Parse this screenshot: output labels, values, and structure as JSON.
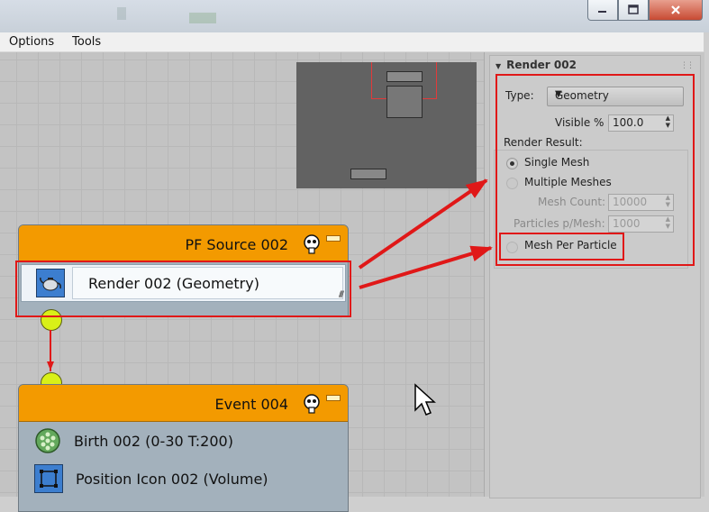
{
  "menu": {
    "items": [
      "Options",
      "Tools"
    ]
  },
  "nodes": {
    "source": {
      "title": "PF Source 002",
      "operator": "Render 002 (Geometry)"
    },
    "event": {
      "title": "Event 004",
      "operators": [
        "Birth 002 (0-30 T:200)",
        "Position Icon 002 (Volume)"
      ]
    }
  },
  "panel": {
    "rollout_title": "Render 002",
    "type_label": "Type:",
    "type_value": "Geometry",
    "visible_label": "Visible %",
    "visible_value": "100.0",
    "render_result_label": "Render Result:",
    "single_mesh": "Single Mesh",
    "multiple_meshes": "Multiple Meshes",
    "mesh_count_label": "Mesh Count:",
    "mesh_count_value": "10000",
    "particles_per_mesh_label": "Particles p/Mesh:",
    "particles_per_mesh_value": "1000",
    "mesh_per_particle": "Mesh Per Particle",
    "selected_option": "Single Mesh"
  },
  "colors": {
    "highlight": "#e01818",
    "node_header": "#f39a00",
    "port": "#d9f017",
    "selected_icon": "#3c7ecf"
  },
  "icons": [
    "minimize-icon",
    "maximize-icon",
    "close-icon",
    "skull-icon",
    "teapot-icon",
    "birth-icon",
    "position-icon",
    "mouse-cursor-icon"
  ]
}
